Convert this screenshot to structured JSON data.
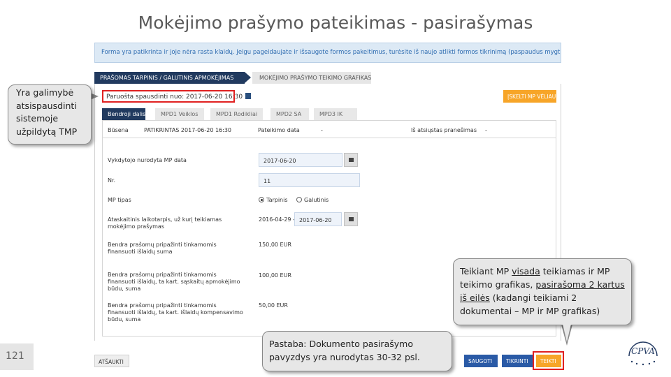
{
  "slide": {
    "title": "Mokėjimo prašymo pateikimas - pasirašymas",
    "page_number": "121"
  },
  "info_bar": {
    "text": "Forma yra patikrinta ir joje nėra rasta klaidų. Jeigu pageidaujate ir išsaugote formos pakeitimus, turėsite iš naujo atlikti formos tikrinimą (paspaudus mygtuką Tikrinti)"
  },
  "tabs": {
    "tab1": "PRAŠOMAS TARPINIS / GALUTINIS APMOKĖJIMAS",
    "tab2": "MOKĖJIMO PRAŠYMO TEIKIMO GRAFIKAS"
  },
  "printed": {
    "text": "Paruošta spausdinti nuo: 2017-06-20 16:30"
  },
  "cancel_mp_label": "ĮSKELTI MP VĖLIAU",
  "subtabs": [
    "Bendroji dalis",
    "MPD1 Veiklos",
    "MPD1 Rodikliai",
    "MPD2 SA",
    "MPD3 IK"
  ],
  "status": {
    "label": "Būsena",
    "value": "PATIKRINTAS  2017-06-20 16:30",
    "submit_date_label": "Pateikimo data",
    "submit_date_value": "-",
    "notice_label": "Iš atsiųstas pranešimas",
    "notice_value": "-"
  },
  "form": {
    "date_label": "Vykdytojo nurodyta MP data",
    "date_value": "2017-06-20",
    "nr_label": "Nr.",
    "nr_value": "11",
    "type_label": "MP tipas",
    "type_option1": "Tarpinis",
    "type_option2": "Galutinis",
    "period_label": "Ataskaitinis laikotarpis, už kurį teikiamas mokėjimo prašymas",
    "period_from": "2016-04-29 -",
    "period_to": "2017-06-20",
    "total_label": "Bendra prašomų pripažinti tinkamomis finansuoti išlaidų suma",
    "total_value": "150,00 EUR",
    "invoice_label": "Bendra prašomų pripažinti tinkamomis finansuoti išlaidų, ta kart. sąskaitų apmokėjimo būdu, suma",
    "invoice_value": "100,00 EUR",
    "comp_label": "Bendra prašomų pripažinti tinkamomis finansuoti išlaidų, ta kart. išlaidų kompensavimo būdu, suma",
    "comp_value": "50,00 EUR"
  },
  "callouts": {
    "left": "Yra galimybė atsispausdinti sistemoje užpildytą TMP",
    "right_part1": "Teikiant MP ",
    "right_u1": "visada",
    "right_part2": " teikiamas ir MP teikimo grafikas, ",
    "right_u2": "pasirašoma 2 kartus iš eilės",
    "right_part3": " (kadangi teikiami 2 dokumentai – MP ir MP grafikas)",
    "note": "Pastaba: Dokumento pasirašymo pavyzdys yra nurodytas 30-32 psl."
  },
  "buttons": {
    "cancel": "ATŠAUKTI",
    "save": "SAUGOTI",
    "check": "TIKRINTI",
    "submit": "TEIKTI"
  },
  "logo": {
    "text": "CPVA"
  },
  "colors": {
    "nav_dark": "#213a5f",
    "accent_orange": "#f7a528",
    "button_blue": "#2a5aa6",
    "highlight_red": "#e02020",
    "info_blue": "#dce9f5"
  }
}
